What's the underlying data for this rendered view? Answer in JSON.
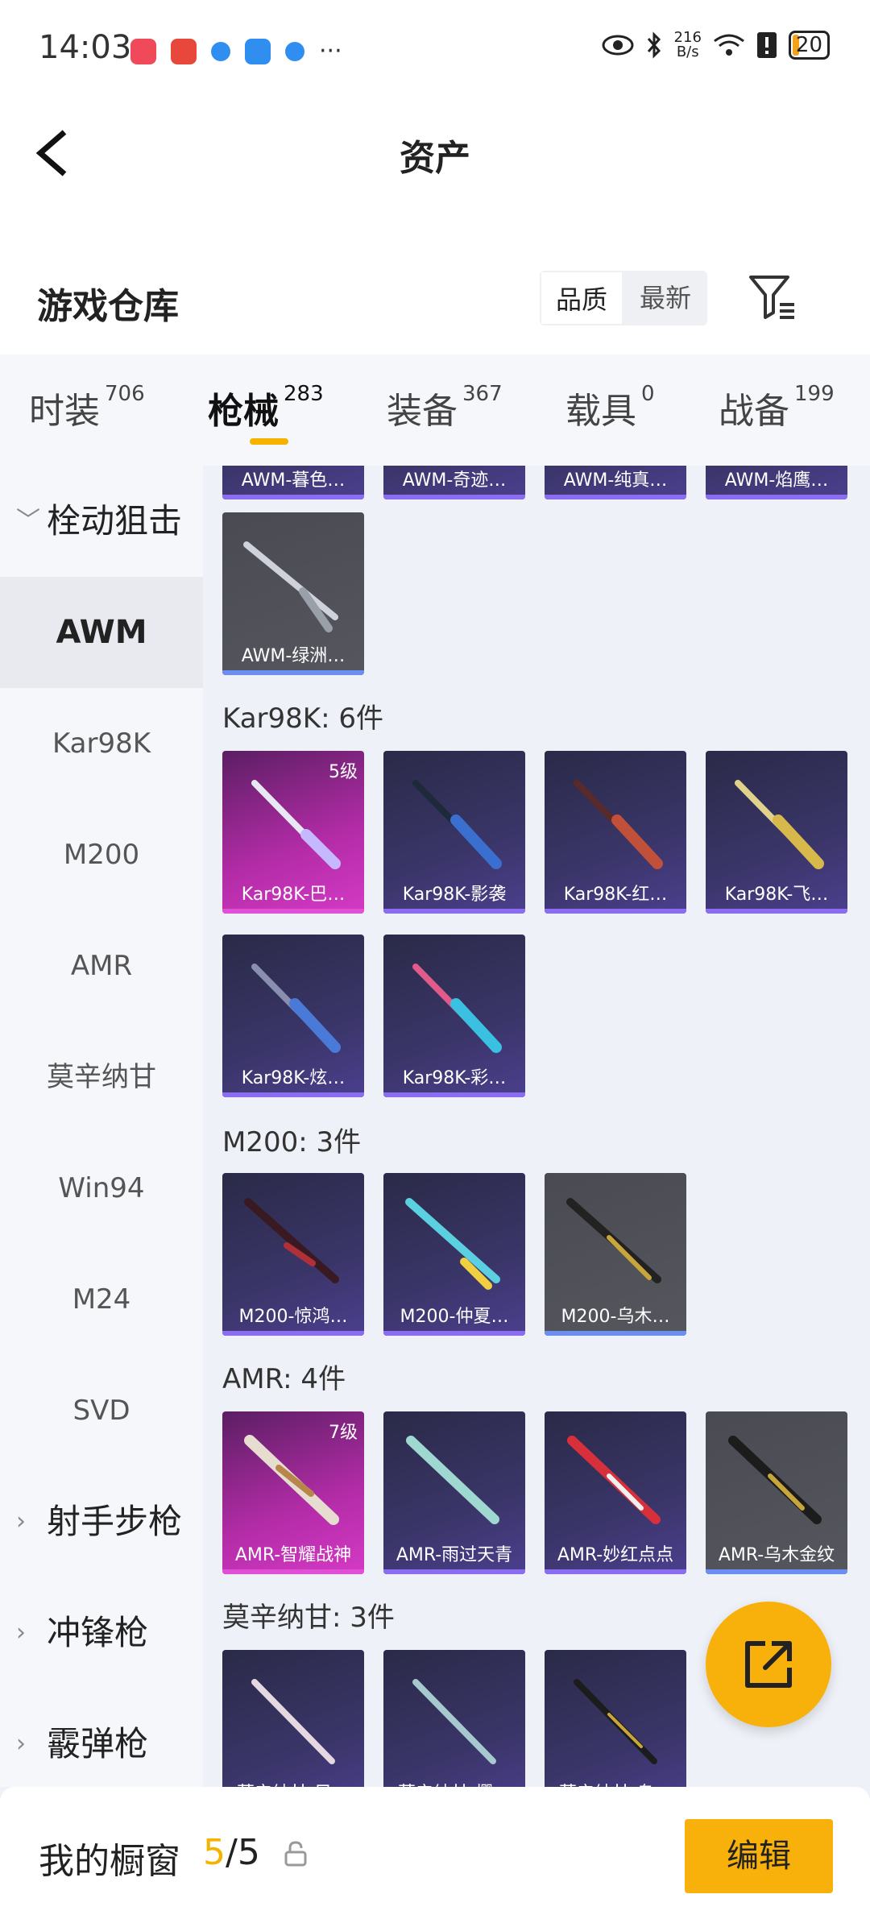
{
  "status_bar": {
    "time": "14:03",
    "more": "···",
    "net_speed_value": "216",
    "net_speed_unit": "B/s",
    "battery": "20"
  },
  "header": {
    "title": "资产"
  },
  "section": {
    "title": "游戏仓库",
    "sort_options": [
      "品质",
      "最新"
    ],
    "active_sort": "品质"
  },
  "tabs": [
    {
      "label": "时装",
      "count": "706"
    },
    {
      "label": "枪械",
      "count": "283"
    },
    {
      "label": "装备",
      "count": "367"
    },
    {
      "label": "载具",
      "count": "0"
    },
    {
      "label": "战备",
      "count": "199"
    }
  ],
  "active_tab": "枪械",
  "leftnav": {
    "items": [
      {
        "label": "栓动狙击",
        "type": "group",
        "expanded": true
      },
      {
        "label": "AWM",
        "type": "item",
        "selected": true
      },
      {
        "label": "Kar98K",
        "type": "item"
      },
      {
        "label": "M200",
        "type": "item"
      },
      {
        "label": "AMR",
        "type": "item"
      },
      {
        "label": "莫辛纳甘",
        "type": "item"
      },
      {
        "label": "Win94",
        "type": "item"
      },
      {
        "label": "M24",
        "type": "item"
      },
      {
        "label": "SVD",
        "type": "item"
      },
      {
        "label": "射手步枪",
        "type": "group"
      },
      {
        "label": "冲锋枪",
        "type": "group"
      },
      {
        "label": "霰弹枪",
        "type": "group"
      }
    ]
  },
  "groups": {
    "awm_top": [
      "AWM-暮色…",
      "AWM-奇迹…",
      "AWM-纯真…",
      "AWM-焰鹰…"
    ],
    "awm_single": {
      "label": "AWM-绿洲…"
    },
    "kar98k": {
      "title": "Kar98K: 6件",
      "items": [
        {
          "label": "Kar98K-巴…",
          "level": "5级"
        },
        {
          "label": "Kar98K-影袭"
        },
        {
          "label": "Kar98K-红…"
        },
        {
          "label": "Kar98K-飞…"
        },
        {
          "label": "Kar98K-炫…"
        },
        {
          "label": "Kar98K-彩…"
        }
      ]
    },
    "m200": {
      "title": "M200: 3件",
      "items": [
        {
          "label": "M200-惊鸿…"
        },
        {
          "label": "M200-仲夏…"
        },
        {
          "label": "M200-乌木…"
        }
      ]
    },
    "amr": {
      "title": "AMR: 4件",
      "items": [
        {
          "label": "AMR-智耀战神",
          "level": "7级"
        },
        {
          "label": "AMR-雨过天青"
        },
        {
          "label": "AMR-妙红点点"
        },
        {
          "label": "AMR-乌木金纹"
        }
      ]
    },
    "mosin": {
      "title": "莫辛纳甘: 3件",
      "items": [
        {
          "label": "莫辛纳甘-风…"
        },
        {
          "label": "莫辛纳甘-樱…"
        },
        {
          "label": "莫辛纳甘-乌…"
        }
      ]
    }
  },
  "bottom_bar": {
    "label": "我的橱窗",
    "current": "5",
    "separator": "/",
    "total": "5",
    "edit_label": "编辑"
  },
  "colors": {
    "accent": "#f7b10a",
    "tab_underline": "#f5b300",
    "rarity_purple": "#8a6df0",
    "rarity_pink": "#e04fd6",
    "rarity_gray_blue": "#6b8ef0"
  }
}
